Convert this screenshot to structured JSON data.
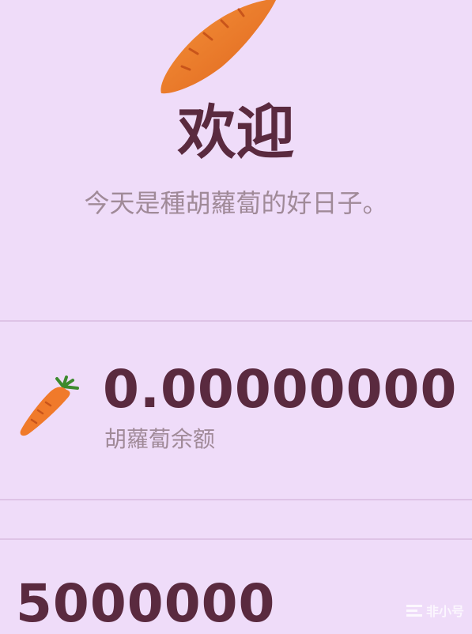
{
  "hero": {
    "icon": "carrot-icon",
    "title": "欢迎",
    "subtitle": "今天是種胡蘿蔔的好日子。"
  },
  "balance": {
    "icon": "carrot-icon",
    "value": "0.00000000",
    "label": "胡蘿蔔余额"
  },
  "secondary": {
    "value": "5000000"
  },
  "watermark": {
    "text": "非小号"
  },
  "colors": {
    "background": "#efdcf9",
    "primary_text": "#5a2a3f",
    "secondary_text": "#a08a98",
    "divider": "#dec3e6",
    "carrot": "#f07a2a"
  }
}
